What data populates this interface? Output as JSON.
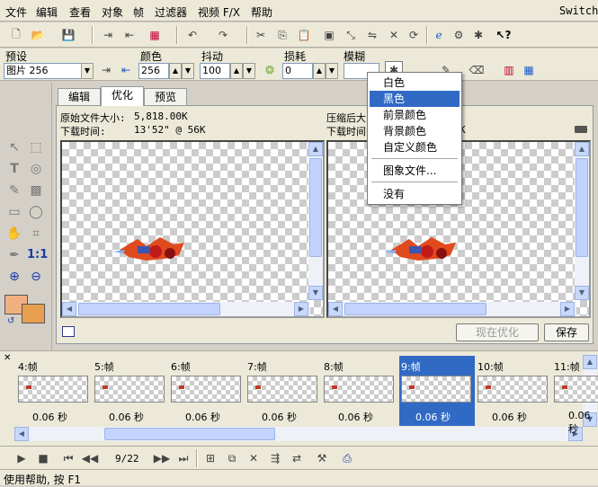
{
  "menubar": {
    "items": [
      "文件",
      "编辑",
      "查看",
      "对象",
      "帧",
      "过滤器",
      "视频 F/X",
      "帮助"
    ],
    "switch_label": "Switch"
  },
  "settings": {
    "preset_label": "预设",
    "preset_value": "图片 256",
    "color_label": "颜色",
    "color_value": "256",
    "dither_label": "抖动",
    "dither_value": "100",
    "loss_label": "损耗",
    "loss_value": "0",
    "blur_label": "模糊"
  },
  "tabs": [
    "编辑",
    "优化",
    "预览"
  ],
  "left_info": {
    "size_label": "原始文件大小:",
    "size_value": "5,818.00K",
    "time_label": "下载时间:",
    "time_value": "13'52\" @ 56K"
  },
  "right_info": {
    "size_label": "压缩后大",
    "time_label": "下载时间",
    "time_suffix": "K"
  },
  "context_menu": {
    "items": [
      "白色",
      "黑色",
      "前景颜色",
      "背景颜色",
      "自定义颜色",
      "图象文件...",
      "没有"
    ],
    "highlighted": "黑色"
  },
  "buttons": {
    "optimize_now": "现在优化",
    "save": "保存"
  },
  "frames": [
    {
      "label": "4:帧",
      "delay": "0.06 秒"
    },
    {
      "label": "5:帧",
      "delay": "0.06 秒"
    },
    {
      "label": "6:帧",
      "delay": "0.06 秒"
    },
    {
      "label": "7:帧",
      "delay": "0.06 秒"
    },
    {
      "label": "8:帧",
      "delay": "0.06 秒"
    },
    {
      "label": "9:帧",
      "delay": "0.06 秒",
      "selected": true
    },
    {
      "label": "10:帧",
      "delay": "0.06 秒"
    },
    {
      "label": "11:帧",
      "delay": "0.06 秒"
    }
  ],
  "playback": {
    "frame_counter": "9/22"
  },
  "status": {
    "text": "使用帮助, 按 F1"
  },
  "colors": {
    "selection": "#316ac5",
    "foreground_swatch": "#f0b080",
    "background_swatch": "#e8a050"
  },
  "zoom_label": "1:1"
}
